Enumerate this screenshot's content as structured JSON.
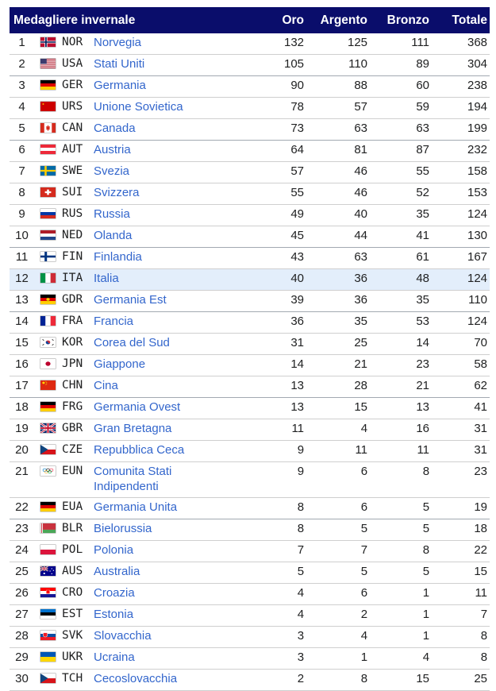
{
  "table": {
    "title": "Medagliere invernale",
    "headers": {
      "gold": "Oro",
      "silver": "Argento",
      "bronze": "Bronzo",
      "total": "Totale"
    },
    "highlight_color": "#e3eefb",
    "header_color": "#0a0d6b",
    "link_color": "#3366cc",
    "rows": [
      {
        "rank": "1",
        "code": "NOR",
        "name": "Norvegia",
        "gold": "132",
        "silver": "125",
        "bronze": "111",
        "total": "368",
        "flag": "flag-norway-icon"
      },
      {
        "rank": "2",
        "code": "USA",
        "name": "Stati Uniti",
        "gold": "105",
        "silver": "110",
        "bronze": "89",
        "total": "304",
        "flag": "flag-usa-icon"
      },
      {
        "rank": "3",
        "code": "GER",
        "name": "Germania",
        "gold": "90",
        "silver": "88",
        "bronze": "60",
        "total": "238",
        "flag": "flag-germany-icon"
      },
      {
        "rank": "4",
        "code": "URS",
        "name": "Unione Sovietica",
        "gold": "78",
        "silver": "57",
        "bronze": "59",
        "total": "194",
        "flag": "flag-ussr-icon"
      },
      {
        "rank": "5",
        "code": "CAN",
        "name": "Canada",
        "gold": "73",
        "silver": "63",
        "bronze": "63",
        "total": "199",
        "flag": "flag-canada-icon"
      },
      {
        "rank": "6",
        "code": "AUT",
        "name": "Austria",
        "gold": "64",
        "silver": "81",
        "bronze": "87",
        "total": "232",
        "flag": "flag-austria-icon"
      },
      {
        "rank": "7",
        "code": "SWE",
        "name": "Svezia",
        "gold": "57",
        "silver": "46",
        "bronze": "55",
        "total": "158",
        "flag": "flag-sweden-icon"
      },
      {
        "rank": "8",
        "code": "SUI",
        "name": "Svizzera",
        "gold": "55",
        "silver": "46",
        "bronze": "52",
        "total": "153",
        "flag": "flag-switzerland-icon"
      },
      {
        "rank": "9",
        "code": "RUS",
        "name": "Russia",
        "gold": "49",
        "silver": "40",
        "bronze": "35",
        "total": "124",
        "flag": "flag-russia-icon"
      },
      {
        "rank": "10",
        "code": "NED",
        "name": "Olanda",
        "gold": "45",
        "silver": "44",
        "bronze": "41",
        "total": "130",
        "flag": "flag-netherlands-icon"
      },
      {
        "rank": "11",
        "code": "FIN",
        "name": "Finlandia",
        "gold": "43",
        "silver": "63",
        "bronze": "61",
        "total": "167",
        "flag": "flag-finland-icon"
      },
      {
        "rank": "12",
        "code": "ITA",
        "name": "Italia",
        "gold": "40",
        "silver": "36",
        "bronze": "48",
        "total": "124",
        "flag": "flag-italy-icon",
        "highlight": true
      },
      {
        "rank": "13",
        "code": "GDR",
        "name": "Germania Est",
        "gold": "39",
        "silver": "36",
        "bronze": "35",
        "total": "110",
        "flag": "flag-east-germany-icon"
      },
      {
        "rank": "14",
        "code": "FRA",
        "name": "Francia",
        "gold": "36",
        "silver": "35",
        "bronze": "53",
        "total": "124",
        "flag": "flag-france-icon"
      },
      {
        "rank": "15",
        "code": "KOR",
        "name": "Corea del Sud",
        "gold": "31",
        "silver": "25",
        "bronze": "14",
        "total": "70",
        "flag": "flag-south-korea-icon"
      },
      {
        "rank": "16",
        "code": "JPN",
        "name": "Giappone",
        "gold": "14",
        "silver": "21",
        "bronze": "23",
        "total": "58",
        "flag": "flag-japan-icon"
      },
      {
        "rank": "17",
        "code": "CHN",
        "name": "Cina",
        "gold": "13",
        "silver": "28",
        "bronze": "21",
        "total": "62",
        "flag": "flag-china-icon"
      },
      {
        "rank": "18",
        "code": "FRG",
        "name": "Germania Ovest",
        "gold": "13",
        "silver": "15",
        "bronze": "13",
        "total": "41",
        "flag": "flag-west-germany-icon"
      },
      {
        "rank": "19",
        "code": "GBR",
        "name": "Gran Bretagna",
        "gold": "11",
        "silver": "4",
        "bronze": "16",
        "total": "31",
        "flag": "flag-uk-icon"
      },
      {
        "rank": "20",
        "code": "CZE",
        "name": "Repubblica Ceca",
        "gold": "9",
        "silver": "11",
        "bronze": "11",
        "total": "31",
        "flag": "flag-czech-icon"
      },
      {
        "rank": "21",
        "code": "EUN",
        "name": "Comunita Stati Indipendenti",
        "gold": "9",
        "silver": "6",
        "bronze": "8",
        "total": "23",
        "flag": "flag-olympic-icon",
        "tall": true
      },
      {
        "rank": "22",
        "code": "EUA",
        "name": "Germania Unita",
        "gold": "8",
        "silver": "6",
        "bronze": "5",
        "total": "19",
        "flag": "flag-germany-icon"
      },
      {
        "rank": "23",
        "code": "BLR",
        "name": "Bielorussia",
        "gold": "8",
        "silver": "5",
        "bronze": "5",
        "total": "18",
        "flag": "flag-belarus-icon"
      },
      {
        "rank": "24",
        "code": "POL",
        "name": "Polonia",
        "gold": "7",
        "silver": "7",
        "bronze": "8",
        "total": "22",
        "flag": "flag-poland-icon"
      },
      {
        "rank": "25",
        "code": "AUS",
        "name": "Australia",
        "gold": "5",
        "silver": "5",
        "bronze": "5",
        "total": "15",
        "flag": "flag-australia-icon"
      },
      {
        "rank": "26",
        "code": "CRO",
        "name": "Croazia",
        "gold": "4",
        "silver": "6",
        "bronze": "1",
        "total": "11",
        "flag": "flag-croatia-icon"
      },
      {
        "rank": "27",
        "code": "EST",
        "name": "Estonia",
        "gold": "4",
        "silver": "2",
        "bronze": "1",
        "total": "7",
        "flag": "flag-estonia-icon"
      },
      {
        "rank": "28",
        "code": "SVK",
        "name": "Slovacchia",
        "gold": "3",
        "silver": "4",
        "bronze": "1",
        "total": "8",
        "flag": "flag-slovakia-icon"
      },
      {
        "rank": "29",
        "code": "UKR",
        "name": "Ucraina",
        "gold": "3",
        "silver": "1",
        "bronze": "4",
        "total": "8",
        "flag": "flag-ukraine-icon"
      },
      {
        "rank": "30",
        "code": "TCH",
        "name": "Cecoslovacchia",
        "gold": "2",
        "silver": "8",
        "bronze": "15",
        "total": "25",
        "flag": "flag-czech-icon"
      }
    ]
  }
}
